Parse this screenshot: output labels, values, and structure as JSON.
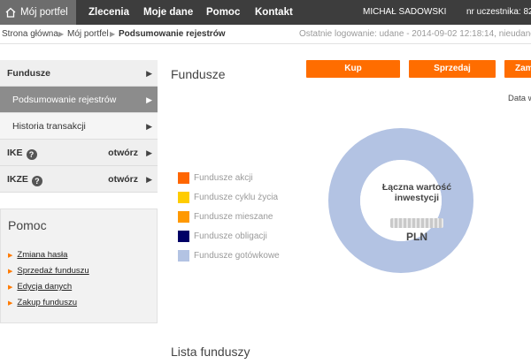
{
  "nav": {
    "home_label": "Mój portfel",
    "items": [
      "Zlecenia",
      "Moje dane",
      "Pomoc",
      "Kontakt"
    ],
    "user_name": "MICHAŁ SADOWSKI",
    "participant": "nr uczestnika: 82"
  },
  "breadcrumb": {
    "items": [
      "Strona główna",
      "Mój portfel",
      "Podsumowanie rejestrów"
    ],
    "last_login": "Ostatnie logowanie: udane - 2014-09-02 12:18:14, nieudane - 2"
  },
  "sidebar": {
    "fundusze": "Fundusze",
    "podsumowanie": "Podsumowanie rejestrów",
    "historia": "Historia transakcji",
    "ike": "IKE",
    "ike_action": "otwórz",
    "ikze": "IKZE",
    "ikze_action": "otwórz"
  },
  "help": {
    "title": "Pomoc",
    "links": [
      "Zmiana hasła",
      "Sprzedaż funduszu",
      "Edycja danych",
      "Zakup funduszu"
    ]
  },
  "main": {
    "title": "Fundusze",
    "buttons": [
      "Kup",
      "Sprzedaj",
      "Zam"
    ],
    "date_label": "Data w",
    "list_title": "Lista funduszy"
  },
  "chart_data": {
    "type": "pie",
    "title": "",
    "categories": [
      "Fundusze akcji",
      "Fundusze cyklu życia",
      "Fundusze mieszane",
      "Fundusze obligacji",
      "Fundusze gotówkowe"
    ],
    "colors": [
      "#ff6600",
      "#ffcc00",
      "#ff9900",
      "#000066",
      "#b3c3e3"
    ],
    "values": [
      0,
      0,
      0,
      0,
      100
    ],
    "center_label": "Łączna wartość inwestycji",
    "center_unit": "PLN"
  }
}
